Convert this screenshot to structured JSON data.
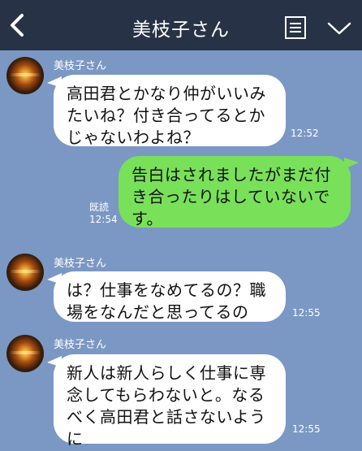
{
  "header": {
    "title": "美枝子さん",
    "back_icon": "back-chevron-icon",
    "menu_icon": "menu-icon",
    "expand_icon": "chevron-down-icon",
    "bg_color": "#273246"
  },
  "chat": {
    "bg_color": "#7b98c4",
    "messages": [
      {
        "sender": "美枝子さん",
        "lines": [
          "高田君とかなり仲がいいみ",
          "たいね？付き合ってるとか",
          "じゃないわよね？"
        ],
        "time": "12:52",
        "side": "left"
      },
      {
        "lines": [
          "告白はされましたがまだ付",
          "き合ったりはしていないで",
          "す。"
        ],
        "time": "12:54",
        "read": "既読",
        "side": "right",
        "color": "#79e05a"
      },
      {
        "sender": "美枝子さん",
        "lines": [
          "は？仕事をなめてるの？職",
          "場をなんだと思ってるの"
        ],
        "time": "12:55",
        "side": "left"
      },
      {
        "sender": "美枝子さん",
        "lines": [
          "新人は新人らしく仕事に専",
          "念してもらわないと。なる",
          "べく高田君と話さないよう",
          "に"
        ],
        "time": "12:55",
        "side": "left"
      }
    ]
  }
}
